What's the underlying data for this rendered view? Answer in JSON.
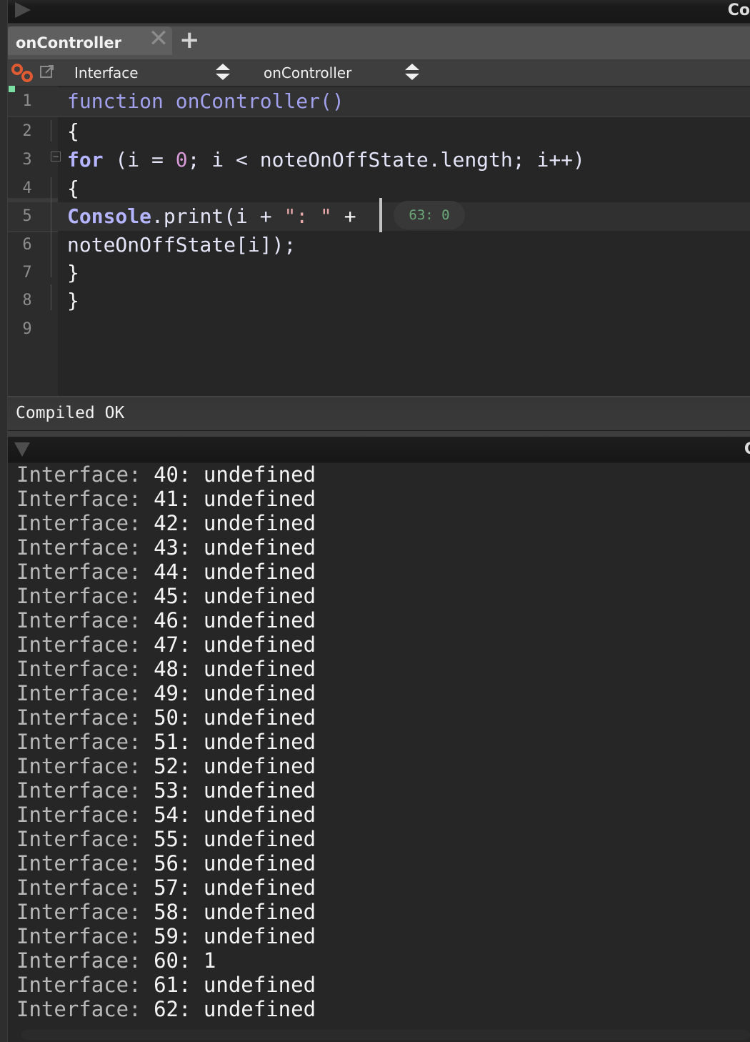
{
  "topbar": {
    "run_icon": "play-icon",
    "right_label_partial": "Co"
  },
  "tabs": [
    {
      "label": "onController",
      "close_icon": "close-icon"
    }
  ],
  "add_tab_icon": "plus-icon",
  "toolbar": {
    "link_icon": "link-icon",
    "popout_icon": "popout-icon",
    "processor_select": "Interface",
    "callback_select": "onController"
  },
  "editor": {
    "lines": [
      {
        "num": "1",
        "tokens": [
          {
            "t": "function ",
            "c": "kw"
          },
          {
            "t": "onController()",
            "c": "kw"
          }
        ]
      },
      {
        "num": "2",
        "tokens": [
          {
            "t": "{",
            "c": "wht"
          }
        ]
      },
      {
        "num": "3",
        "tokens": [
          {
            "t": "for",
            "c": "kwb"
          },
          {
            "t": " (i = ",
            "c": ""
          },
          {
            "t": "0",
            "c": "num0"
          },
          {
            "t": "; i < noteOnOffState.length; i++)",
            "c": ""
          }
        ]
      },
      {
        "num": "4",
        "tokens": [
          {
            "t": "{",
            "c": "wht"
          }
        ]
      },
      {
        "num": "5",
        "tokens": [
          {
            "t": "Console",
            "c": "kwb"
          },
          {
            "t": ".print(i + ",
            "c": ""
          },
          {
            "t": "\": \"",
            "c": "str"
          },
          {
            "t": " +",
            "c": "wht"
          }
        ]
      },
      {
        "num": "6",
        "tokens": [
          {
            "t": "noteOnOffState[i]);",
            "c": ""
          }
        ]
      },
      {
        "num": "7",
        "tokens": [
          {
            "t": "}",
            "c": "wht"
          }
        ]
      },
      {
        "num": "8",
        "tokens": [
          {
            "t": "}",
            "c": "wht"
          }
        ]
      },
      {
        "num": "9",
        "tokens": []
      }
    ],
    "inline_hint": "63: 0"
  },
  "status": {
    "text": "Compiled OK"
  },
  "console": {
    "collapse_icon": "triangle-down-icon",
    "right_label_partial": "C",
    "prefix": "Interface: ",
    "lines": [
      {
        "key": "40",
        "val": "undefined"
      },
      {
        "key": "41",
        "val": "undefined"
      },
      {
        "key": "42",
        "val": "undefined"
      },
      {
        "key": "43",
        "val": "undefined"
      },
      {
        "key": "44",
        "val": "undefined"
      },
      {
        "key": "45",
        "val": "undefined"
      },
      {
        "key": "46",
        "val": "undefined"
      },
      {
        "key": "47",
        "val": "undefined"
      },
      {
        "key": "48",
        "val": "undefined"
      },
      {
        "key": "49",
        "val": "undefined"
      },
      {
        "key": "50",
        "val": "undefined"
      },
      {
        "key": "51",
        "val": "undefined"
      },
      {
        "key": "52",
        "val": "undefined"
      },
      {
        "key": "53",
        "val": "undefined"
      },
      {
        "key": "54",
        "val": "undefined"
      },
      {
        "key": "55",
        "val": "undefined"
      },
      {
        "key": "56",
        "val": "undefined"
      },
      {
        "key": "57",
        "val": "undefined"
      },
      {
        "key": "58",
        "val": "undefined"
      },
      {
        "key": "59",
        "val": "undefined"
      },
      {
        "key": "60",
        "val": "1"
      },
      {
        "key": "61",
        "val": "undefined"
      },
      {
        "key": "62",
        "val": "undefined"
      }
    ]
  },
  "colors": {
    "keyword": "#a0a0ec",
    "number_literal": "#d89bd8",
    "string_literal": "#e6a8a8",
    "hint_text": "#6aa878",
    "link_icon": "#e05a32",
    "modified_marker": "#7ce0a4"
  }
}
